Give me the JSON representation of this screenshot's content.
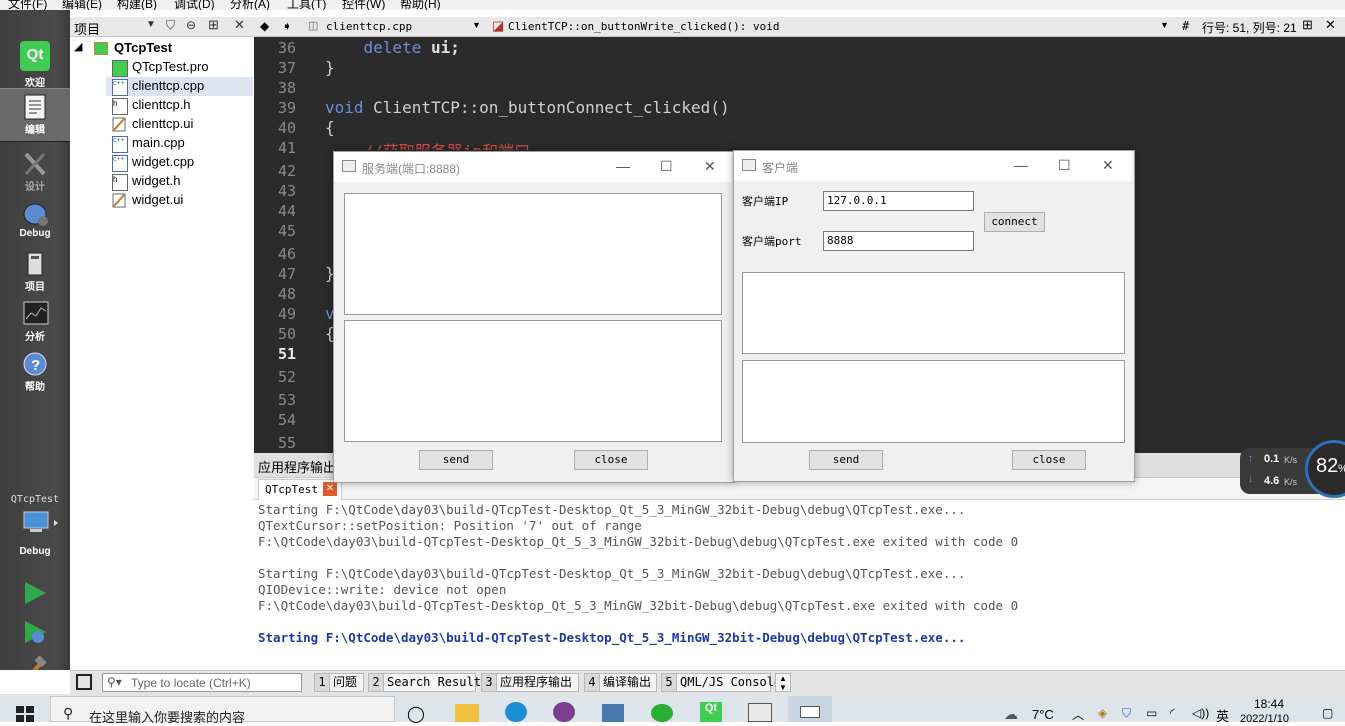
{
  "menu": [
    "文件(F)",
    "编辑(E)",
    "构建(B)",
    "调试(D)",
    "分析(A)",
    "工具(T)",
    "控件(W)",
    "帮助(H)"
  ],
  "modes": [
    {
      "label": "欢迎",
      "icon": "qt-logo-icon"
    },
    {
      "label": "编辑",
      "icon": "edit-document-icon"
    },
    {
      "label": "设计",
      "icon": "design-pencil-icon"
    },
    {
      "label": "Debug",
      "icon": "debug-bug-icon"
    },
    {
      "label": "项目",
      "icon": "project-wrench-icon"
    },
    {
      "label": "分析",
      "icon": "analyze-icon"
    },
    {
      "label": "帮助",
      "icon": "help-icon"
    }
  ],
  "kit": {
    "project": "QTcpTest",
    "mode": "Debug"
  },
  "project_panel": {
    "title": "项目",
    "root": "QTcpTest",
    "files": [
      "QTcpTest.pro",
      "clienttcp.cpp",
      "clienttcp.h",
      "clienttcp.ui",
      "main.cpp",
      "widget.cpp",
      "widget.h",
      "widget.ui"
    ],
    "selected": "clienttcp.cpp"
  },
  "editor": {
    "file": "clienttcp.cpp",
    "function": "ClientTCP::on_buttonWrite_clicked(): void",
    "position": "行号: 51, 列号: 21",
    "hash": "#",
    "line_numbers": [
      "36",
      "37",
      "38",
      "39",
      "40",
      "41",
      "42",
      "43",
      "44",
      "45",
      "46",
      "47",
      "48",
      "49",
      "50",
      "51",
      "52",
      "53",
      "54",
      "55"
    ],
    "current_line": "51",
    "lines": [
      {
        "kw": "    delete",
        "rest": " ui;"
      },
      {
        "kw": "",
        "rest": "}"
      },
      {
        "kw": "",
        "rest": ""
      },
      {
        "kw": "void",
        "rest": " ClientTCP::on_buttonConnect_clicked()"
      },
      {
        "kw": "",
        "rest": "{"
      },
      {
        "kw": "",
        "rest": "    //获取服务器ip和端口"
      },
      {
        "kw": "",
        "rest": "}"
      },
      {
        "kw": "",
        "rest": "v"
      },
      {
        "kw": "",
        "rest": "{"
      }
    ]
  },
  "output": {
    "header": "应用程序输出",
    "tab": "QTcpTest",
    "lines": [
      "Starting F:\\QtCode\\day03\\build-QTcpTest-Desktop_Qt_5_3_MinGW_32bit-Debug\\debug\\QTcpTest.exe...",
      "QTextCursor::setPosition: Position '7' out of range",
      "F:\\QtCode\\day03\\build-QTcpTest-Desktop_Qt_5_3_MinGW_32bit-Debug\\debug\\QTcpTest.exe exited with code 0",
      "",
      "Starting F:\\QtCode\\day03\\build-QTcpTest-Desktop_Qt_5_3_MinGW_32bit-Debug\\debug\\QTcpTest.exe...",
      "QIODevice::write: device not open",
      "F:\\QtCode\\day03\\build-QTcpTest-Desktop_Qt_5_3_MinGW_32bit-Debug\\debug\\QTcpTest.exe exited with code 0",
      "",
      "Starting F:\\QtCode\\day03\\build-QTcpTest-Desktop_Qt_5_3_MinGW_32bit-Debug\\debug\\QTcpTest.exe..."
    ]
  },
  "status": {
    "locate_placeholder": "Type to locate (Ctrl+K)",
    "panes": [
      {
        "num": "1",
        "label": "问题"
      },
      {
        "num": "2",
        "label": "Search Results"
      },
      {
        "num": "3",
        "label": "应用程序输出"
      },
      {
        "num": "4",
        "label": "编译输出"
      },
      {
        "num": "5",
        "label": "QML/JS Console"
      }
    ]
  },
  "server_window": {
    "title": "服务端(端口:8888)",
    "send": "send",
    "close": "close"
  },
  "client_window": {
    "title": "客户端",
    "ip_label": "客户端IP",
    "ip_value": "127.0.0.1",
    "port_label": "客户端port",
    "port_value": "8888",
    "connect": "connect",
    "send": "send",
    "close": "close"
  },
  "network_widget": {
    "up": "0.1",
    "down": "4.6",
    "unit": "K/s",
    "cpu": "82",
    "cpu_unit": "%"
  },
  "taskbar": {
    "search_placeholder": "在这里输入你要搜索的内容",
    "weather": "7°C",
    "ime": "英",
    "time": "18:44",
    "date": "2022/1/10"
  },
  "colors": {
    "keyword": "#6b8fd6",
    "comment": "#d64b4b",
    "selected_file": "#dbe4f0",
    "run_green": "#2fa84f"
  }
}
